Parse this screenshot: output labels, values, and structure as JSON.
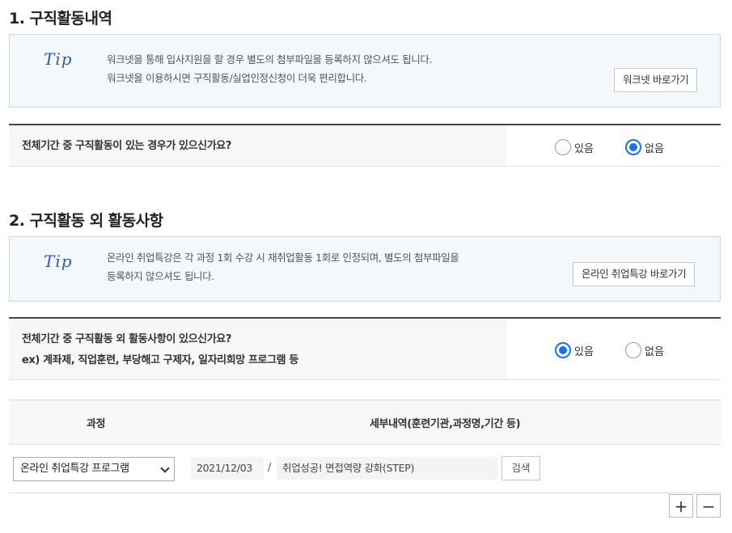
{
  "section1": {
    "title": "1. 구직활동내역",
    "tip": {
      "logo": "Tip",
      "line1": "워크넷을 통해 입사지원을 할 경우 별도의 첨부파일을 등록하지 않으셔도 됩니다.",
      "line2": "워크넷을 이용하시면 구직활동/실업인정신청이 더욱 편리합니다.",
      "button": "워크넷 바로가기"
    },
    "question": "전체기간 중 구직활동이 있는 경우가 있으신가요?",
    "options": [
      "있음",
      "없음"
    ],
    "selected": "없음"
  },
  "section2": {
    "title": "2. 구직활동 외 활동사항",
    "tip": {
      "logo": "Tip",
      "line1": "온라인 취업특강은 각 과정 1회 수강 시 재취업활동 1회로 인정되며, 별도의 첨부파일을",
      "line2": "등록하지 않으셔도 됩니다.",
      "button": "온라인 취업특강 바로가기"
    },
    "question_line1": "전체기간 중 구직활동 외 활동사항이 있으신가요?",
    "question_line2": "ex) 계좌제, 직업훈련, 부당해고 구제자, 일자리희망 프로그램 등",
    "options": [
      "있음",
      "없음"
    ],
    "selected": "있음",
    "table": {
      "headers": [
        "과정",
        "세부내역(훈련기관,과정명,기간 등)"
      ],
      "rows": [
        {
          "course": "온라인 취업특강 프로그램",
          "date": "2021/12/03",
          "separator": "/",
          "detail": "취업성공! 면접역량 강화(STEP)",
          "search_button": "검색"
        }
      ],
      "add_button": "+",
      "remove_button": "−"
    }
  }
}
